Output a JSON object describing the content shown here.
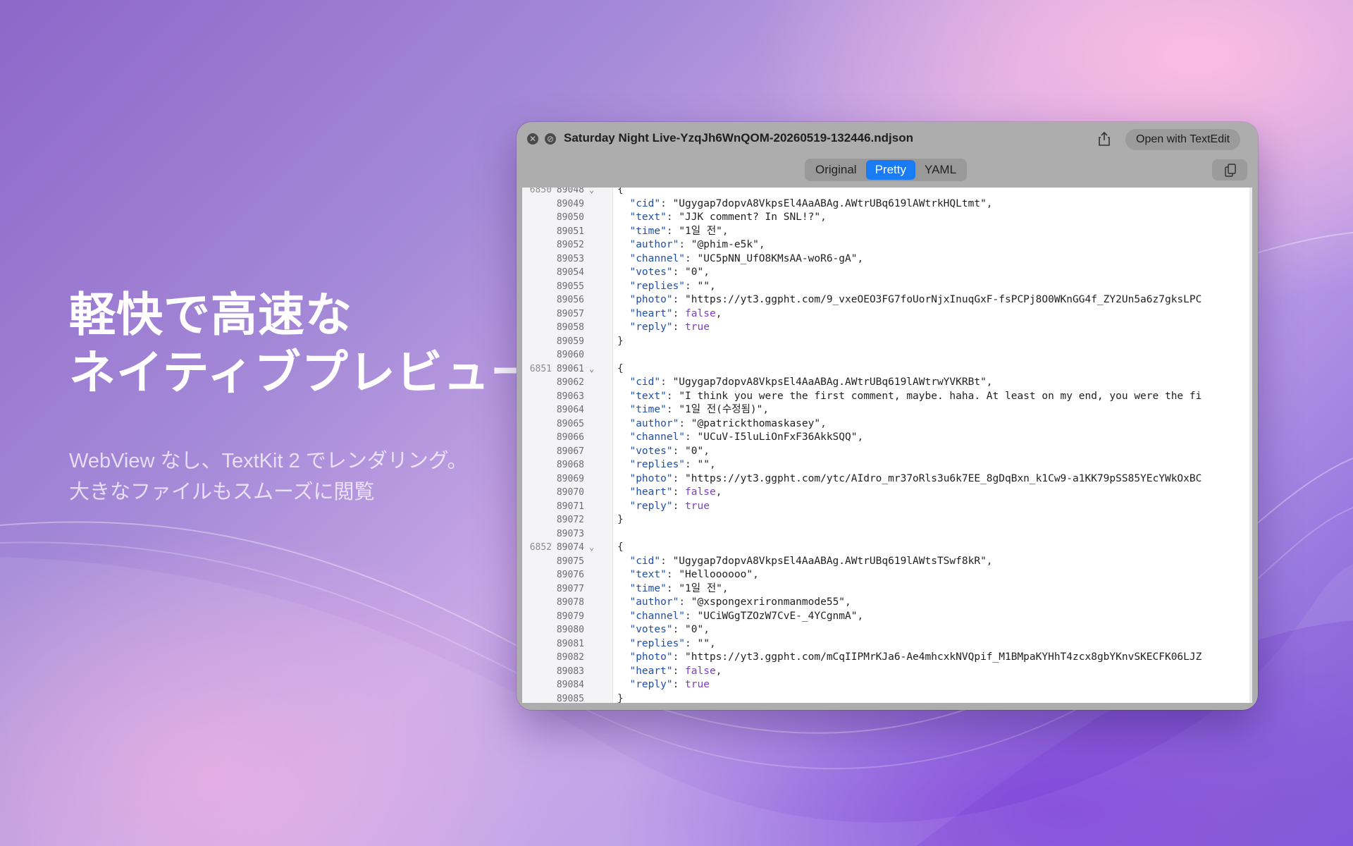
{
  "hero": {
    "title_lines": [
      "軽快で高速な",
      "ネイティブプレビュー"
    ],
    "subtitle_lines": [
      "WebView なし、TextKit 2 でレンダリング。",
      "大きなファイルもスムーズに閲覧"
    ]
  },
  "window": {
    "title": "Saturday Night Live-YzqJh6WnQOM-20260519-132446.ndjson",
    "open_button": "Open with TextEdit",
    "tabs": [
      {
        "label": "Original",
        "active": false
      },
      {
        "label": "Pretty",
        "active": true
      },
      {
        "label": "YAML",
        "active": false
      }
    ],
    "icons": {
      "close": "close-icon",
      "block": "no-entry-icon",
      "share": "share-icon",
      "copy": "copy-icon"
    }
  },
  "editor": {
    "colors": {
      "key": "#1f4fa6",
      "bool": "#7b3fbf",
      "accent": "#1a7cf5"
    },
    "lines": [
      {
        "rec": "6850",
        "ln": "89048",
        "fold": true,
        "tokens": [
          [
            "p",
            "{"
          ]
        ]
      },
      {
        "rec": "",
        "ln": "89049",
        "tokens": [
          [
            "k",
            "  \"cid\""
          ],
          [
            "p",
            ": "
          ],
          [
            "s",
            "\"Ugygap7dopvA8VkpsEl4AaABAg.AWtrUBq619lAWtrkHQLtmt\""
          ],
          [
            "p",
            ","
          ]
        ]
      },
      {
        "rec": "",
        "ln": "89050",
        "tokens": [
          [
            "k",
            "  \"text\""
          ],
          [
            "p",
            ": "
          ],
          [
            "s",
            "\"JJK comment? In SNL!?\""
          ],
          [
            "p",
            ","
          ]
        ]
      },
      {
        "rec": "",
        "ln": "89051",
        "tokens": [
          [
            "k",
            "  \"time\""
          ],
          [
            "p",
            ": "
          ],
          [
            "s",
            "\"1일 전\""
          ],
          [
            "p",
            ","
          ]
        ]
      },
      {
        "rec": "",
        "ln": "89052",
        "tokens": [
          [
            "k",
            "  \"author\""
          ],
          [
            "p",
            ": "
          ],
          [
            "s",
            "\"@phim-e5k\""
          ],
          [
            "p",
            ","
          ]
        ]
      },
      {
        "rec": "",
        "ln": "89053",
        "tokens": [
          [
            "k",
            "  \"channel\""
          ],
          [
            "p",
            ": "
          ],
          [
            "s",
            "\"UC5pNN_UfO8KMsAA-woR6-gA\""
          ],
          [
            "p",
            ","
          ]
        ]
      },
      {
        "rec": "",
        "ln": "89054",
        "tokens": [
          [
            "k",
            "  \"votes\""
          ],
          [
            "p",
            ": "
          ],
          [
            "s",
            "\"0\""
          ],
          [
            "p",
            ","
          ]
        ]
      },
      {
        "rec": "",
        "ln": "89055",
        "tokens": [
          [
            "k",
            "  \"replies\""
          ],
          [
            "p",
            ": "
          ],
          [
            "s",
            "\"\""
          ],
          [
            "p",
            ","
          ]
        ]
      },
      {
        "rec": "",
        "ln": "89056",
        "tokens": [
          [
            "k",
            "  \"photo\""
          ],
          [
            "p",
            ": "
          ],
          [
            "s",
            "\"https://yt3.ggpht.com/9_vxeOEO3FG7foUorNjxInuqGxF-fsPCPj8O0WKnGG4f_ZY2Un5a6z7gksLPC"
          ]
        ]
      },
      {
        "rec": "",
        "ln": "89057",
        "tokens": [
          [
            "k",
            "  \"heart\""
          ],
          [
            "p",
            ": "
          ],
          [
            "b",
            "false"
          ],
          [
            "p",
            ","
          ]
        ]
      },
      {
        "rec": "",
        "ln": "89058",
        "tokens": [
          [
            "k",
            "  \"reply\""
          ],
          [
            "p",
            ": "
          ],
          [
            "b",
            "true"
          ]
        ]
      },
      {
        "rec": "",
        "ln": "89059",
        "tokens": [
          [
            "p",
            "}"
          ]
        ]
      },
      {
        "rec": "",
        "ln": "89060",
        "tokens": []
      },
      {
        "rec": "6851",
        "ln": "89061",
        "fold": true,
        "tokens": [
          [
            "p",
            "{"
          ]
        ]
      },
      {
        "rec": "",
        "ln": "89062",
        "tokens": [
          [
            "k",
            "  \"cid\""
          ],
          [
            "p",
            ": "
          ],
          [
            "s",
            "\"Ugygap7dopvA8VkpsEl4AaABAg.AWtrUBq619lAWtrwYVKRBt\""
          ],
          [
            "p",
            ","
          ]
        ]
      },
      {
        "rec": "",
        "ln": "89063",
        "tokens": [
          [
            "k",
            "  \"text\""
          ],
          [
            "p",
            ": "
          ],
          [
            "s",
            "\"I think you were the first comment, maybe. haha. At least on my end, you were the fi"
          ]
        ]
      },
      {
        "rec": "",
        "ln": "89064",
        "tokens": [
          [
            "k",
            "  \"time\""
          ],
          [
            "p",
            ": "
          ],
          [
            "s",
            "\"1일 전(수정됨)\""
          ],
          [
            "p",
            ","
          ]
        ]
      },
      {
        "rec": "",
        "ln": "89065",
        "tokens": [
          [
            "k",
            "  \"author\""
          ],
          [
            "p",
            ": "
          ],
          [
            "s",
            "\"@patrickthomaskasey\""
          ],
          [
            "p",
            ","
          ]
        ]
      },
      {
        "rec": "",
        "ln": "89066",
        "tokens": [
          [
            "k",
            "  \"channel\""
          ],
          [
            "p",
            ": "
          ],
          [
            "s",
            "\"UCuV-I5luLiOnFxF36AkkSQQ\""
          ],
          [
            "p",
            ","
          ]
        ]
      },
      {
        "rec": "",
        "ln": "89067",
        "tokens": [
          [
            "k",
            "  \"votes\""
          ],
          [
            "p",
            ": "
          ],
          [
            "s",
            "\"0\""
          ],
          [
            "p",
            ","
          ]
        ]
      },
      {
        "rec": "",
        "ln": "89068",
        "tokens": [
          [
            "k",
            "  \"replies\""
          ],
          [
            "p",
            ": "
          ],
          [
            "s",
            "\"\""
          ],
          [
            "p",
            ","
          ]
        ]
      },
      {
        "rec": "",
        "ln": "89069",
        "tokens": [
          [
            "k",
            "  \"photo\""
          ],
          [
            "p",
            ": "
          ],
          [
            "s",
            "\"https://yt3.ggpht.com/ytc/AIdro_mr37oRls3u6k7EE_8gDqBxn_k1Cw9-a1KK79pSS85YEcYWkOxBC"
          ]
        ]
      },
      {
        "rec": "",
        "ln": "89070",
        "tokens": [
          [
            "k",
            "  \"heart\""
          ],
          [
            "p",
            ": "
          ],
          [
            "b",
            "false"
          ],
          [
            "p",
            ","
          ]
        ]
      },
      {
        "rec": "",
        "ln": "89071",
        "tokens": [
          [
            "k",
            "  \"reply\""
          ],
          [
            "p",
            ": "
          ],
          [
            "b",
            "true"
          ]
        ]
      },
      {
        "rec": "",
        "ln": "89072",
        "tokens": [
          [
            "p",
            "}"
          ]
        ]
      },
      {
        "rec": "",
        "ln": "89073",
        "tokens": []
      },
      {
        "rec": "6852",
        "ln": "89074",
        "fold": true,
        "tokens": [
          [
            "p",
            "{"
          ]
        ]
      },
      {
        "rec": "",
        "ln": "89075",
        "tokens": [
          [
            "k",
            "  \"cid\""
          ],
          [
            "p",
            ": "
          ],
          [
            "s",
            "\"Ugygap7dopvA8VkpsEl4AaABAg.AWtrUBq619lAWtsTSwf8kR\""
          ],
          [
            "p",
            ","
          ]
        ]
      },
      {
        "rec": "",
        "ln": "89076",
        "tokens": [
          [
            "k",
            "  \"text\""
          ],
          [
            "p",
            ": "
          ],
          [
            "s",
            "\"Helloooooo\""
          ],
          [
            "p",
            ","
          ]
        ]
      },
      {
        "rec": "",
        "ln": "89077",
        "tokens": [
          [
            "k",
            "  \"time\""
          ],
          [
            "p",
            ": "
          ],
          [
            "s",
            "\"1일 전\""
          ],
          [
            "p",
            ","
          ]
        ]
      },
      {
        "rec": "",
        "ln": "89078",
        "tokens": [
          [
            "k",
            "  \"author\""
          ],
          [
            "p",
            ": "
          ],
          [
            "s",
            "\"@xspongexrironmanmode55\""
          ],
          [
            "p",
            ","
          ]
        ]
      },
      {
        "rec": "",
        "ln": "89079",
        "tokens": [
          [
            "k",
            "  \"channel\""
          ],
          [
            "p",
            ": "
          ],
          [
            "s",
            "\"UCiWGgTZOzW7CvE-_4YCgnmA\""
          ],
          [
            "p",
            ","
          ]
        ]
      },
      {
        "rec": "",
        "ln": "89080",
        "tokens": [
          [
            "k",
            "  \"votes\""
          ],
          [
            "p",
            ": "
          ],
          [
            "s",
            "\"0\""
          ],
          [
            "p",
            ","
          ]
        ]
      },
      {
        "rec": "",
        "ln": "89081",
        "tokens": [
          [
            "k",
            "  \"replies\""
          ],
          [
            "p",
            ": "
          ],
          [
            "s",
            "\"\""
          ],
          [
            "p",
            ","
          ]
        ]
      },
      {
        "rec": "",
        "ln": "89082",
        "tokens": [
          [
            "k",
            "  \"photo\""
          ],
          [
            "p",
            ": "
          ],
          [
            "s",
            "\"https://yt3.ggpht.com/mCqIIPMrKJa6-Ae4mhcxkNVQpif_M1BMpaKYHhT4zcx8gbYKnvSKECFK06LJZ"
          ]
        ]
      },
      {
        "rec": "",
        "ln": "89083",
        "tokens": [
          [
            "k",
            "  \"heart\""
          ],
          [
            "p",
            ": "
          ],
          [
            "b",
            "false"
          ],
          [
            "p",
            ","
          ]
        ]
      },
      {
        "rec": "",
        "ln": "89084",
        "tokens": [
          [
            "k",
            "  \"reply\""
          ],
          [
            "p",
            ": "
          ],
          [
            "b",
            "true"
          ]
        ]
      },
      {
        "rec": "",
        "ln": "89085",
        "tokens": [
          [
            "p",
            "}"
          ]
        ]
      }
    ]
  }
}
